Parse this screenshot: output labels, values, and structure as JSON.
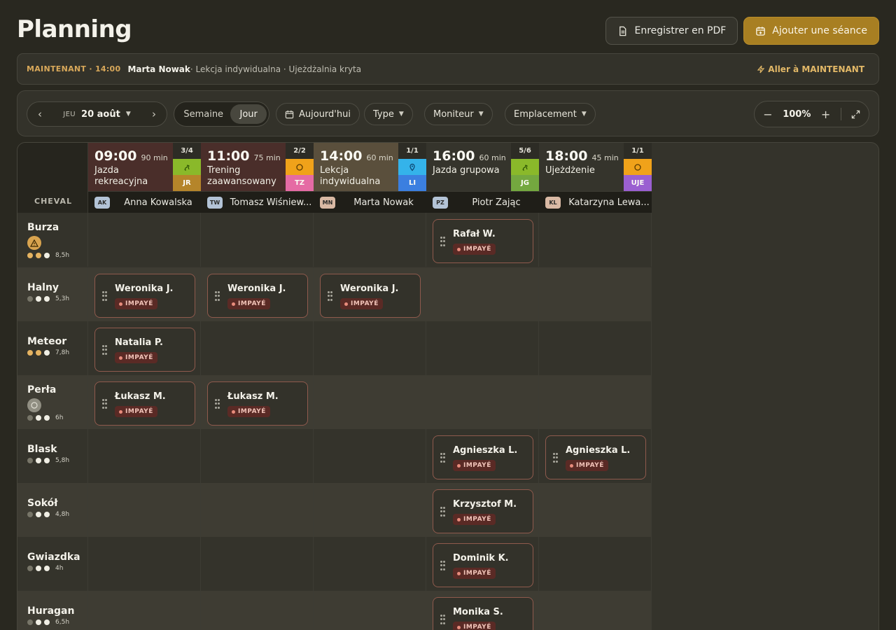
{
  "page": {
    "title": "Planning",
    "export_pdf_label": "Enregistrer en PDF",
    "add_session_label": "Ajouter une séance"
  },
  "now_bar": {
    "label": "MAINTENANT · 14:00",
    "name": "Marta Nowak",
    "details": " · Lekcja indywidualna · Ujeżdżalnia kryta",
    "goto_label": "Aller à MAINTENANT"
  },
  "toolbar": {
    "day_of_week": "JEU",
    "date": "20 août",
    "view_week": "Semaine",
    "view_day": "Jour",
    "today_label": "Aujourd'hui",
    "filter_type": "Type",
    "filter_instructor": "Moniteur",
    "filter_location": "Emplacement",
    "zoom": "100%"
  },
  "grid": {
    "corner_label": "CHEVAL",
    "sessions": [
      {
        "time": "09:00",
        "duration": "90 min",
        "name": "Jazda rekreacyjna",
        "count": "3/4",
        "code": "JR",
        "instructor_initials": "AK",
        "instructor": "Anna Kowalska",
        "bg": "#4a2e2a",
        "type_color": "#8ab92a",
        "code_color": "#b5852a",
        "icon": "horse-icon"
      },
      {
        "time": "11:00",
        "duration": "75 min",
        "name": "Trening zaawansowany",
        "count": "2/2",
        "code": "TZ",
        "instructor_initials": "TW",
        "instructor": "Tomasz Wiśniew...",
        "bg": "#4a2e2a",
        "type_color": "#f0a21a",
        "code_color": "#e56ba4",
        "icon": "circle-icon"
      },
      {
        "time": "14:00",
        "duration": "60 min",
        "name": "Lekcja indywidualna",
        "count": "1/1",
        "code": "LI",
        "instructor_initials": "MN",
        "instructor": "Marta Nowak",
        "bg": "#5a4f3c",
        "type_color": "#34b3ea",
        "code_color": "#3b7fe0",
        "icon": "pin-icon"
      },
      {
        "time": "16:00",
        "duration": "60 min",
        "name": "Jazda grupowa",
        "count": "5/6",
        "code": "JG",
        "instructor_initials": "PZ",
        "instructor": "Piotr Zając",
        "bg": "#35342c",
        "type_color": "#8ab92a",
        "code_color": "#74a83f",
        "icon": "horse-icon"
      },
      {
        "time": "18:00",
        "duration": "45 min",
        "name": "Ujeżdżenie",
        "count": "1/1",
        "code": "UJE",
        "instructor_initials": "KL",
        "instructor": "Katarzyna Lewa...",
        "bg": "#35342c",
        "type_color": "#f0a21a",
        "code_color": "#9a5fd1",
        "icon": "circle-icon"
      }
    ],
    "horses": [
      {
        "name": "Burza",
        "hours": "8,5h",
        "dots": [
          "gold",
          "gold",
          "light"
        ],
        "badge": "warning-icon"
      },
      {
        "name": "Halny",
        "hours": "5,3h",
        "dots": [
          "dim",
          "light",
          "light"
        ],
        "badge": ""
      },
      {
        "name": "Meteor",
        "hours": "7,8h",
        "dots": [
          "gold",
          "gold",
          "light"
        ],
        "badge": ""
      },
      {
        "name": "Perła",
        "hours": "6h",
        "dots": [
          "dim",
          "light",
          "light"
        ],
        "badge": "round-icon"
      },
      {
        "name": "Blask",
        "hours": "5,8h",
        "dots": [
          "dim",
          "light",
          "light"
        ],
        "badge": ""
      },
      {
        "name": "Sokół",
        "hours": "4,8h",
        "dots": [
          "dim",
          "light",
          "light"
        ],
        "badge": ""
      },
      {
        "name": "Gwiazdka",
        "hours": "4h",
        "dots": [
          "dim",
          "light",
          "light"
        ],
        "badge": ""
      },
      {
        "name": "Huragan",
        "hours": "6,5h",
        "dots": [
          "dim",
          "light",
          "light"
        ],
        "badge": ""
      }
    ],
    "bookings": [
      {
        "horse": 0,
        "session": 3,
        "name": "Rafał W.",
        "status": "IMPAYÉ"
      },
      {
        "horse": 1,
        "session": 0,
        "name": "Weronika J.",
        "status": "IMPAYÉ"
      },
      {
        "horse": 1,
        "session": 1,
        "name": "Weronika J.",
        "status": "IMPAYÉ"
      },
      {
        "horse": 1,
        "session": 2,
        "name": "Weronika J.",
        "status": "IMPAYÉ"
      },
      {
        "horse": 2,
        "session": 0,
        "name": "Natalia P.",
        "status": "IMPAYÉ"
      },
      {
        "horse": 3,
        "session": 0,
        "name": "Łukasz M.",
        "status": "IMPAYÉ"
      },
      {
        "horse": 3,
        "session": 1,
        "name": "Łukasz M.",
        "status": "IMPAYÉ"
      },
      {
        "horse": 4,
        "session": 3,
        "name": "Agnieszka L.",
        "status": "IMPAYÉ"
      },
      {
        "horse": 4,
        "session": 4,
        "name": "Agnieszka L.",
        "status": "IMPAYÉ"
      },
      {
        "horse": 5,
        "session": 3,
        "name": "Krzysztof M.",
        "status": "IMPAYÉ"
      },
      {
        "horse": 6,
        "session": 3,
        "name": "Dominik K.",
        "status": "IMPAYÉ"
      },
      {
        "horse": 7,
        "session": 3,
        "name": "Monika S.",
        "status": "IMPAYÉ"
      }
    ]
  }
}
